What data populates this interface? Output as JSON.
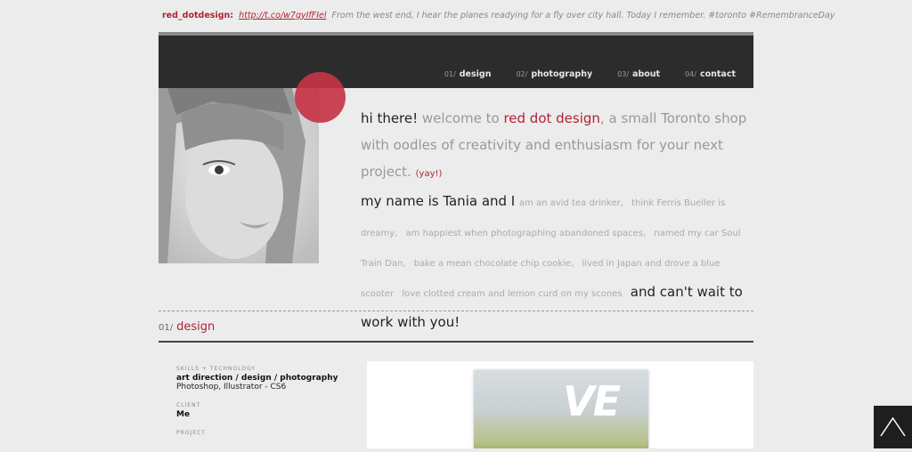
{
  "tweet": {
    "handle": "red_dotdesign:",
    "link": "http://t.co/w7gyIfFIel",
    "message": "From the west end, I hear the planes readying for a fly over city hall. Today I remember. #toronto #RemembranceDay"
  },
  "nav": [
    {
      "num": "01/",
      "label": "design"
    },
    {
      "num": "02/",
      "label": "photography"
    },
    {
      "num": "03/",
      "label": "about"
    },
    {
      "num": "04/",
      "label": "contact"
    }
  ],
  "intro": {
    "greeting": "hi there!",
    "welcome": " welcome to ",
    "brand": "red dot design",
    "rest1": ", a small Toronto shop with oodles of creativity and enthusiasm for your next project.",
    "yay": "(yay!)",
    "name": "my name is Tania and I",
    "facts": [
      "am an avid tea drinker,",
      "think Ferris Bueller is dreamy,",
      "am happiest when photographing abandoned spaces,",
      "named my car Soul Train Dan,",
      "bake a mean chocolate chip cookie,",
      "lived in Japan and drove a blue scooter",
      "love clotted cream and lemon curd on my scones"
    ],
    "closing": "and can't wait to work with you!"
  },
  "section": {
    "num": "01/",
    "title": "design",
    "meta": {
      "skills_label": "SKILLS + TECHNOLOGY",
      "skills_value": "art direction / design / photography",
      "skills_tools": "Photoshop, Illustrator - CS6",
      "client_label": "CLIENT",
      "client_value": "Me",
      "project_label": "PROJECT"
    },
    "preview_text": "VE"
  }
}
